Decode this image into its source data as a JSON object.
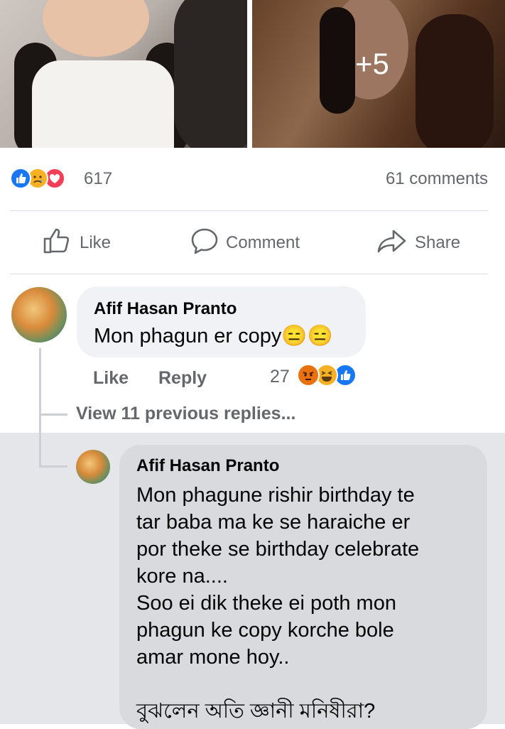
{
  "post": {
    "photos": {
      "extra_count": "+5"
    },
    "reactions": {
      "icons": [
        "like-icon",
        "sad-icon",
        "love-icon"
      ],
      "count": "617",
      "comments": "61 comments"
    },
    "actions": {
      "like": "Like",
      "comment": "Comment",
      "share": "Share"
    }
  },
  "comment": {
    "author": "Afif Hasan Pranto",
    "text": "Mon phagun er copy",
    "emoji": "😑😑",
    "like_label": "Like",
    "reply_label": "Reply",
    "reaction_count": "27",
    "reaction_icons": [
      "angry-icon",
      "haha-icon",
      "like-icon"
    ],
    "view_replies": "View 11 previous replies..."
  },
  "reply": {
    "author": "Afif Hasan Pranto",
    "lines": [
      "Mon phagune rishir birthday te",
      "tar baba ma ke se haraiche er",
      "por theke se birthday celebrate",
      "kore na....",
      "Soo ei dik theke ei poth mon",
      "phagun ke copy korche bole",
      "amar mone hoy..",
      "",
      "বুঝলেন অতি জ্ঞানী মনিষীরা?"
    ]
  },
  "colors": {
    "like_blue": "#1877f2",
    "love_red": "#f33e58",
    "reaction_yellow": "#f7b125",
    "angry_orange": "#e9710f",
    "muted_text": "#65676b",
    "bubble_bg": "#f0f2f5"
  }
}
